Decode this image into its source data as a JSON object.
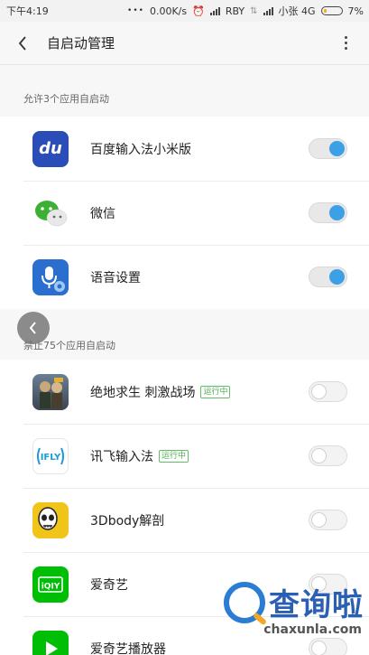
{
  "status_bar": {
    "time": "下午4:19",
    "net_speed": "0.00K/s",
    "carrier1": "RBY",
    "carrier2": "小张 4G",
    "battery": "7%"
  },
  "title_bar": {
    "title": "自启动管理"
  },
  "allowed_section": {
    "header": "允许3个应用自启动",
    "apps": [
      {
        "name": "百度输入法小米版",
        "icon": "baidu-input-icon",
        "enabled": true
      },
      {
        "name": "微信",
        "icon": "wechat-icon",
        "enabled": true
      },
      {
        "name": "语音设置",
        "icon": "voice-settings-icon",
        "enabled": true
      }
    ]
  },
  "blocked_section": {
    "header": "禁止75个应用自启动",
    "apps": [
      {
        "name": "绝地求生 刺激战场",
        "badge": "运行中",
        "icon": "pubg-icon",
        "enabled": false
      },
      {
        "name": "讯飞输入法",
        "badge": "运行中",
        "icon": "ifly-icon",
        "enabled": false
      },
      {
        "name": "3Dbody解剖",
        "icon": "3dbody-icon",
        "enabled": false
      },
      {
        "name": "爱奇艺",
        "icon": "iqiyi-icon",
        "enabled": false
      },
      {
        "name": "爱奇艺播放器",
        "icon": "iqiyi-player-icon",
        "enabled": false
      }
    ]
  },
  "watermark": {
    "text_cn": "查询啦",
    "text_en": "chaxunla.com"
  },
  "colors": {
    "toggle_on": "#3ba0e6",
    "running_badge": "#4caf50",
    "watermark_blue": "#2b5fb3"
  }
}
